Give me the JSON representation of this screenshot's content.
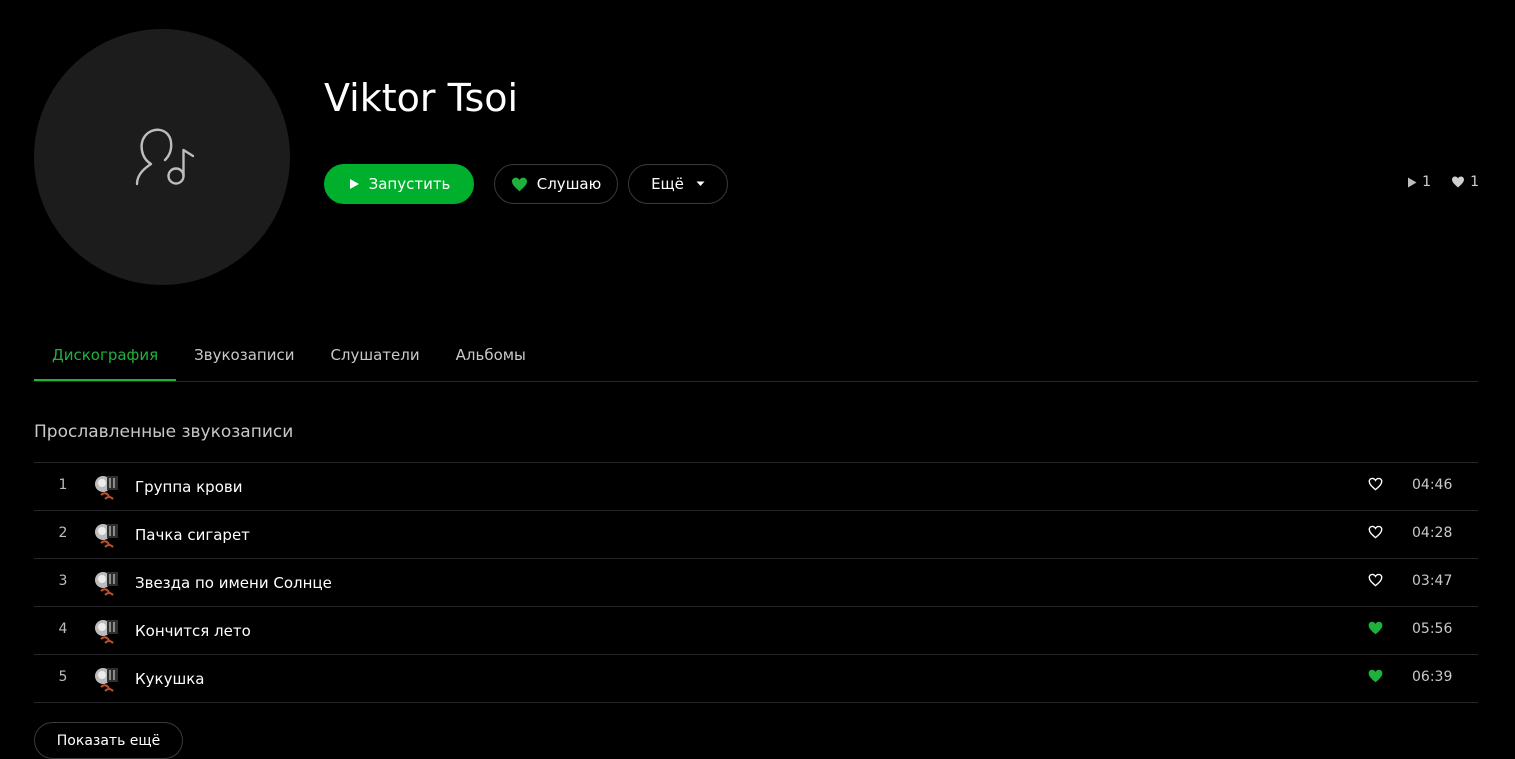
{
  "artist": {
    "name": "Viktor Tsoi"
  },
  "actions": {
    "play_label": "Запустить",
    "listen_label": "Слушаю",
    "more_label": "Ещё"
  },
  "stats": {
    "plays": "1",
    "likes": "1"
  },
  "tabs": [
    {
      "label": "Дискография",
      "active": true
    },
    {
      "label": "Звукозаписи",
      "active": false
    },
    {
      "label": "Слушатели",
      "active": false
    },
    {
      "label": "Альбомы",
      "active": false
    }
  ],
  "section": {
    "title": "Прославленные звукозаписи"
  },
  "tracks": [
    {
      "num": "1",
      "title": "Группа крови",
      "duration": "04:46",
      "liked": false
    },
    {
      "num": "2",
      "title": "Пачка сигарет",
      "duration": "04:28",
      "liked": false
    },
    {
      "num": "3",
      "title": "Звезда по имени Солнце",
      "duration": "03:47",
      "liked": false
    },
    {
      "num": "4",
      "title": "Кончится лето",
      "duration": "05:56",
      "liked": true
    },
    {
      "num": "5",
      "title": "Кукушка",
      "duration": "06:39",
      "liked": true
    }
  ],
  "show_more_label": "Показать ещё",
  "colors": {
    "accent": "#00b02c",
    "background": "#000000",
    "avatar_bg": "#1c1c1c",
    "divider": "#262626"
  },
  "icons": {
    "avatar": "artist-music-note-icon",
    "play": "play-icon",
    "listen": "heart-icon",
    "more": "caret-down-icon",
    "plays_stat": "play-small-icon",
    "likes_stat": "heart-small-icon",
    "like": "heart-outline-icon",
    "liked": "heart-filled-icon"
  }
}
